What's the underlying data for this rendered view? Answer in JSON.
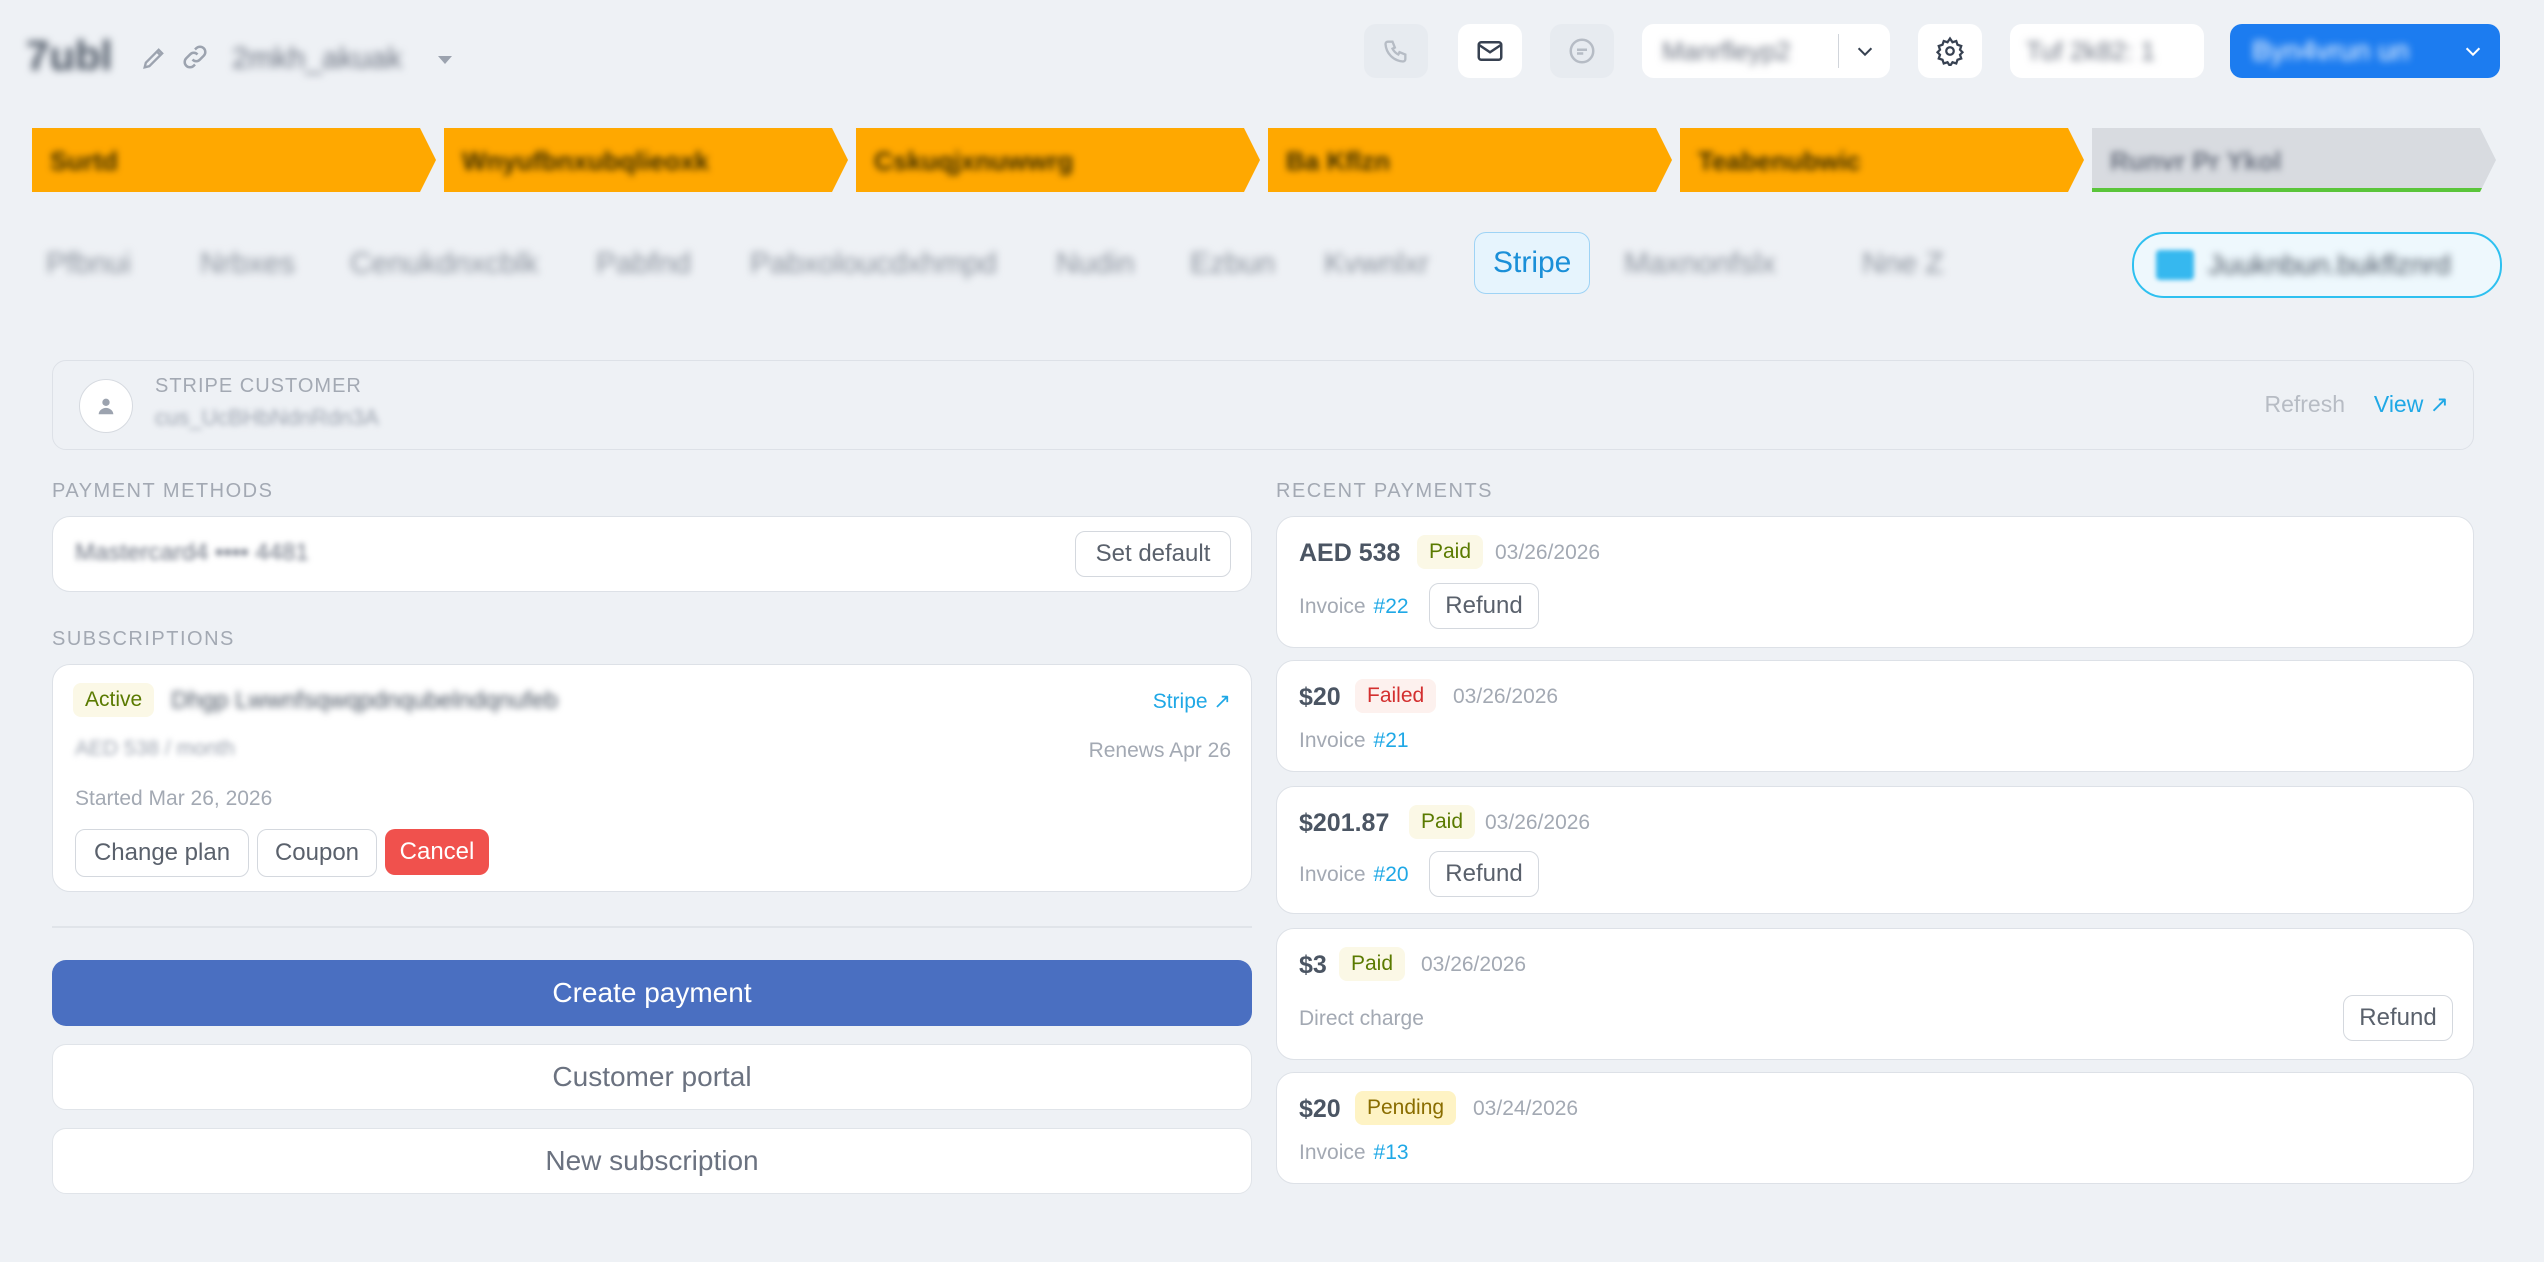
{
  "header": {
    "record_title": "7ubl",
    "record_subtitle": "2mkh_akuak",
    "select_value": "Manrfleyp2",
    "user_label": "Tuf 2k82: 1",
    "primary_button": "Byn4vrun un"
  },
  "pipeline": {
    "stages": [
      {
        "label": "Surtd"
      },
      {
        "label": "Wnyufbnxubqlieoxk"
      },
      {
        "label": "Cskuqjxnuwwrg"
      },
      {
        "label": "Ba Kflzn"
      },
      {
        "label": "Teabenubwic"
      },
      {
        "label": "Runvr Pr Ykol"
      }
    ]
  },
  "tabs": {
    "items": [
      {
        "label": "Pfbnui"
      },
      {
        "label": "Nrbxes"
      },
      {
        "label": "Cenukdnxcblk"
      },
      {
        "label": "Pabfnd"
      },
      {
        "label": "Pabxoloucdxhmpd"
      },
      {
        "label": "Nudin"
      },
      {
        "label": "Ezbun"
      },
      {
        "label": "Kvwnlxr"
      },
      {
        "label": "Stripe"
      },
      {
        "label": "Maxnonfslx"
      },
      {
        "label": "Nne Z"
      }
    ],
    "action_label": "Juuknbun.bukflznrd"
  },
  "customer": {
    "label": "STRIPE CUSTOMER",
    "id": "cus_UcBHbNdnRdn3A",
    "refresh": "Refresh",
    "view": "View ↗"
  },
  "payment_methods": {
    "label": "PAYMENT METHODS",
    "card_masked": "Mastercard4 •••• 4481",
    "set_default": "Set default"
  },
  "subscriptions": {
    "label": "SUBSCRIPTIONS",
    "status": "Active",
    "name": "Dhgp Lwwnfsqwqpdnqubelndqnufeb",
    "stripe_link": "Stripe ↗",
    "price": "AED 538 / month",
    "renews": "Renews Apr 26",
    "started": "Started Mar 26, 2026",
    "change_plan": "Change plan",
    "coupon": "Coupon",
    "cancel": "Cancel"
  },
  "actions": {
    "create_payment": "Create payment",
    "customer_portal": "Customer portal",
    "new_subscription": "New subscription"
  },
  "recent_payments": {
    "label": "RECENT PAYMENTS",
    "items": [
      {
        "amount": "AED 538",
        "status": "Paid",
        "date": "03/26/2026",
        "kind": "Invoice",
        "ref": "#22",
        "refund": "Refund"
      },
      {
        "amount": "$20",
        "status": "Failed",
        "date": "03/26/2026",
        "kind": "Invoice",
        "ref": "#21"
      },
      {
        "amount": "$201.87",
        "status": "Paid",
        "date": "03/26/2026",
        "kind": "Invoice",
        "ref": "#20",
        "refund": "Refund"
      },
      {
        "amount": "$3",
        "status": "Paid",
        "date": "03/26/2026",
        "kind": "Direct charge",
        "refund": "Refund"
      },
      {
        "amount": "$20",
        "status": "Pending",
        "date": "03/24/2026",
        "kind": "Invoice",
        "ref": "#13"
      }
    ]
  },
  "colors": {
    "pipeline_active": "#ffa800",
    "primary_button": "#1c7cf0",
    "create_payment": "#4a6fc1",
    "cancel": "#f0514d",
    "link": "#1fa8e6"
  }
}
